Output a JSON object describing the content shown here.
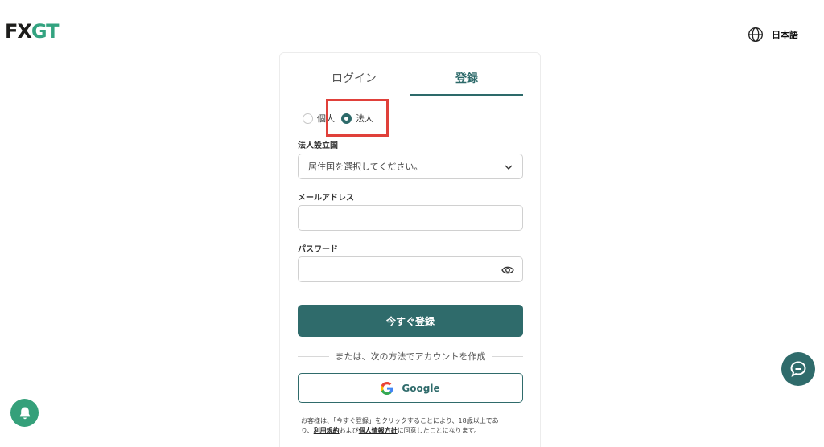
{
  "brand": {
    "logo_fx": "FX",
    "logo_gt": "GT"
  },
  "header": {
    "language_label": "日本語"
  },
  "tabs": [
    {
      "label": "ログイン",
      "active": false
    },
    {
      "label": "登録",
      "active": true
    }
  ],
  "account_type": {
    "individual_label": "個人",
    "corporate_label": "法人",
    "selected": "法人"
  },
  "form": {
    "country_label": "法人設立国",
    "country_placeholder": "居住国を選択してください。",
    "email_label": "メールアドレス",
    "email_value": "",
    "password_label": "パスワード",
    "password_value": "",
    "submit_label": "今すぐ登録"
  },
  "alt": {
    "divider_text": "または、次の方法でアカウントを作成",
    "google_label": "Google"
  },
  "consent": {
    "part1": "お客様は、「今すぐ登録」をクリックすることにより、18歳以上であ",
    "part2": "り、",
    "terms_link": "利用規約",
    "part3": "および",
    "privacy_link": "個人情報方針",
    "part4": "に同意したことになります。"
  },
  "colors": {
    "accent": "#2f6b6b",
    "highlight": "#e0403a",
    "brand_green": "#33a380"
  }
}
